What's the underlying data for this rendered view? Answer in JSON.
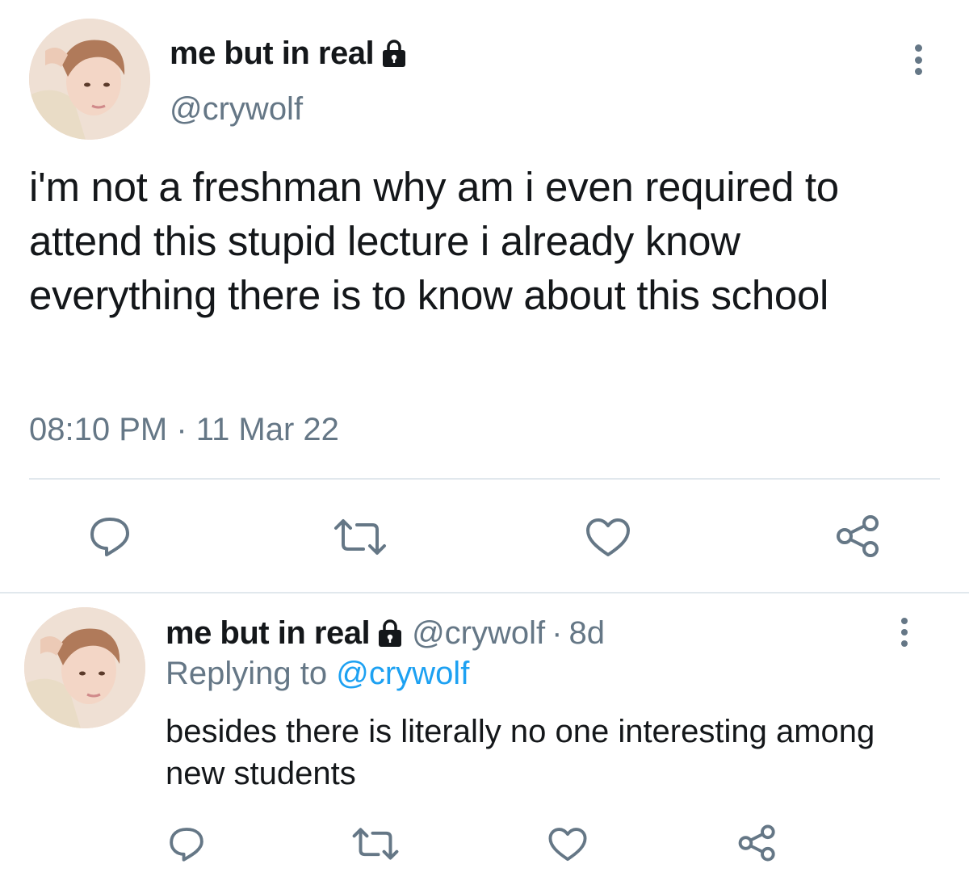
{
  "main_tweet": {
    "display_name": "me but in real",
    "handle": "@crywolf",
    "text": "i'm not a freshman why am i even required to attend this stupid lecture i already know everything there is to know about this school",
    "time": "08:10 PM",
    "separator": "·",
    "date": "11 Mar 22",
    "protected_icon": "lock-icon",
    "more_icon": "more-vertical-icon"
  },
  "actions": {
    "reply_icon": "reply-icon",
    "retweet_icon": "retweet-icon",
    "like_icon": "heart-icon",
    "share_icon": "share-icon"
  },
  "reply_tweet": {
    "display_name": "me but in real",
    "handle": "@crywolf",
    "separator": "·",
    "age": "8d",
    "replying_label": "Replying to",
    "replying_handle": "@crywolf",
    "text": "besides there is literally no one interesting among new students"
  },
  "colors": {
    "text": "#14171a",
    "muted": "#657786",
    "link": "#1da1f2",
    "divider": "#e1e8ed"
  }
}
